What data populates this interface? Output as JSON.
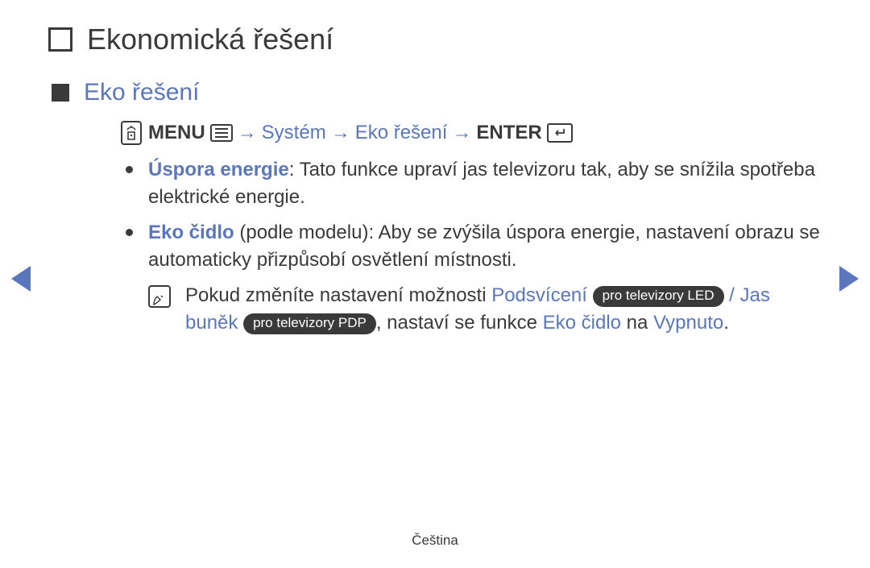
{
  "heading": "Ekonomická řešení",
  "subheading": "Eko řešení",
  "menupath": {
    "menu_label": "MENU",
    "arrow": "→",
    "step1": "Systém",
    "step2": "Eko řešení",
    "enter_label": "ENTER"
  },
  "bullets": [
    {
      "term": "Úspora energie",
      "body": ": Tato funkce upraví jas televizoru tak, aby se snížila spotřeba elektrické energie."
    },
    {
      "term": "Eko čidlo",
      "paren": " (podle modelu)",
      "body": ": Aby se zvýšila úspora energie, nastavení obrazu se automaticky přizpůsobí osvětlení místnosti."
    }
  ],
  "note": {
    "pre": "Pokud změníte nastavení možnosti ",
    "backlight": "Podsvícení",
    "badge_led": "pro televizory LED",
    "slash": " / ",
    "cellbright": "Jas buněk",
    "badge_pdp": "pro televizory PDP",
    "mid": ", nastaví se funkce ",
    "ecosensor": "Eko čidlo",
    "on": " na ",
    "off": "Vypnuto",
    "dot": "."
  },
  "footer": "Čeština"
}
